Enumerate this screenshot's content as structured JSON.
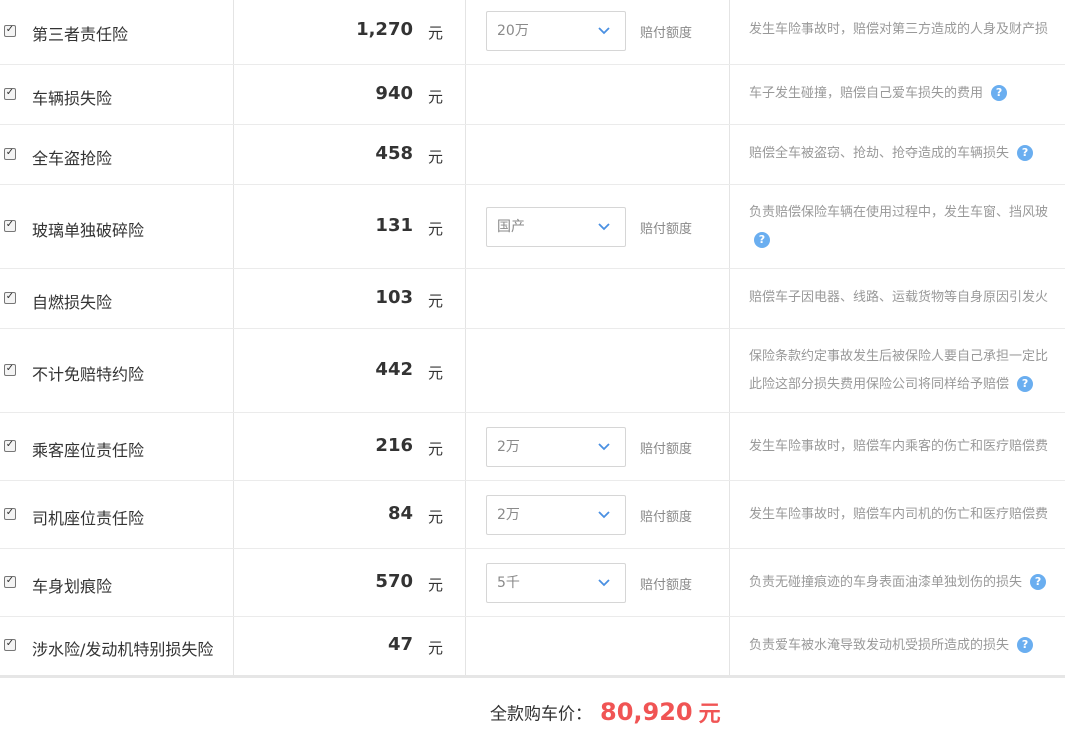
{
  "rows": [
    {
      "name": "第三者责任险",
      "price": "1,270",
      "unit": "元",
      "select_value": "20万",
      "limit_label": "赔付额度",
      "desc": [
        "发生车险事故时，赔偿对第三方造成的人身及财产损"
      ]
    },
    {
      "name": "车辆损失险",
      "price": "940",
      "unit": "元",
      "desc": [
        "车子发生碰撞，赔偿自己爱车损失的费用"
      ]
    },
    {
      "name": "全车盗抢险",
      "price": "458",
      "unit": "元",
      "desc": [
        "赔偿全车被盗窃、抢劫、抢夺造成的车辆损失"
      ]
    },
    {
      "name": "玻璃单独破碎险",
      "price": "131",
      "unit": "元",
      "select_value": "国产",
      "limit_label": "赔付额度",
      "desc": [
        "负责赔偿保险车辆在使用过程中，发生车窗、挡风玻"
      ]
    },
    {
      "name": "自燃损失险",
      "price": "103",
      "unit": "元",
      "desc": [
        "赔偿车子因电器、线路、运载货物等自身原因引发火"
      ]
    },
    {
      "name": "不计免赔特约险",
      "price": "442",
      "unit": "元",
      "desc": [
        "保险条款约定事故发生后被保险人要自己承担一定比",
        "此险这部分损失费用保险公司将同样给予赔偿"
      ]
    },
    {
      "name": "乘客座位责任险",
      "price": "216",
      "unit": "元",
      "select_value": "2万",
      "limit_label": "赔付额度",
      "desc": [
        "发生车险事故时，赔偿车内乘客的伤亡和医疗赔偿费"
      ]
    },
    {
      "name": "司机座位责任险",
      "price": "84",
      "unit": "元",
      "select_value": "2万",
      "limit_label": "赔付额度",
      "desc": [
        "发生车险事故时，赔偿车内司机的伤亡和医疗赔偿费"
      ]
    },
    {
      "name": "车身划痕险",
      "price": "570",
      "unit": "元",
      "select_value": "5千",
      "limit_label": "赔付额度",
      "desc": [
        "负责无碰撞痕迹的车身表面油漆单独划伤的损失"
      ]
    },
    {
      "name": "涉水险/发动机特别损失险",
      "price": "47",
      "unit": "元",
      "desc": [
        "负责爱车被水淹导致发动机受损所造成的损失"
      ]
    }
  ],
  "help_glyph": "?",
  "checkbox_glyph": "✓",
  "total": {
    "label": "全款购车价：",
    "amount": "80,920",
    "currency": "元"
  },
  "colors": {
    "accent_price": "#f05454",
    "help_icon": "#6aaef0"
  }
}
